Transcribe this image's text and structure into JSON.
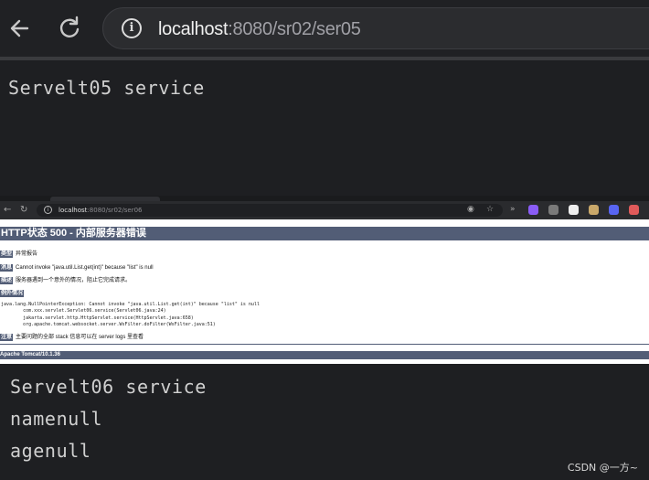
{
  "top_browser": {
    "url_host": "localhost",
    "url_rest": ":8080/sr02/ser05"
  },
  "servlet05": {
    "output": "Servelt05 service"
  },
  "small_browser": {
    "url_host": "localhost",
    "url_rest": ":8080/sr02/ser06",
    "ext_icon_colors": [
      "#8a5cf6",
      "#7a7a7a",
      "#eeeeee",
      "#c9a86a",
      "#5865f2",
      "#e05a5a"
    ]
  },
  "error_page": {
    "title": "HTTP状态 500 - 内部服务器错误",
    "rows": [
      {
        "tag": "类型",
        "text": "异常报告"
      },
      {
        "tag": "消息",
        "text": "Cannot invoke \"java.util.List.get(int)\" because \"list\" is null"
      },
      {
        "tag": "描述",
        "text": "服务器遇到一个意外的情况，阻止它完成请求。"
      }
    ],
    "exception_tag": "例外情况",
    "stack": "java.lang.NullPointerException: Cannot invoke \"java.util.List.get(int)\" because \"list\" is null\n\tcom.xxx.servlet.Servlet06.service(Servlet06.java:24)\n\tjakarta.servlet.http.HttpServlet.service(HttpServlet.java:658)\n\torg.apache.tomcat.websocket.server.WsFilter.doFilter(WsFilter.java:51)",
    "note_tag": "注意",
    "note_text": "主要问题的全部 stack 信息可以在 server logs 里查看",
    "footer": "Apache Tomcat/10.1.36"
  },
  "servlet06": {
    "output": "Servelt06 service",
    "name_line": "namenull",
    "age_line": "agenull"
  },
  "watermark": "CSDN @一方~"
}
